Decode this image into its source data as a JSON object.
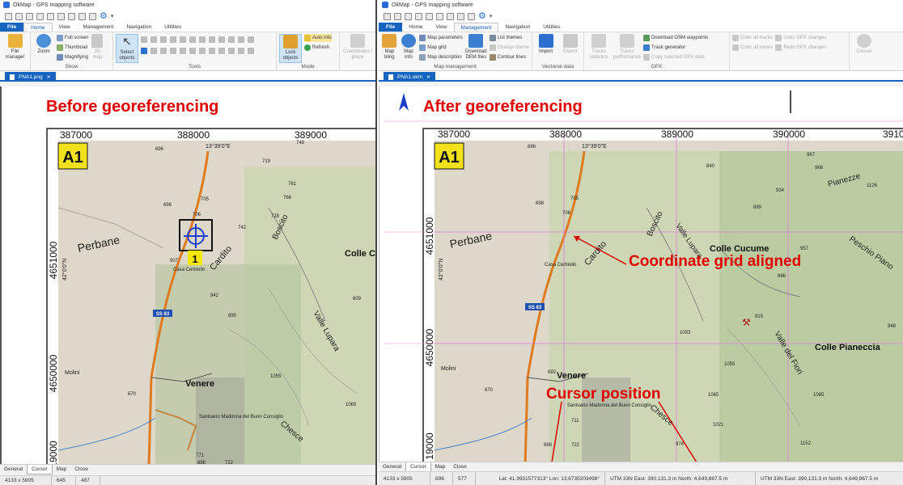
{
  "window": {
    "title": "OkMap - GPS mapping software"
  },
  "tabs": {
    "file": "File",
    "home": "Home",
    "view": "View",
    "management": "Management",
    "navigation": "Navigation",
    "utilities": "Utilities"
  },
  "left_ribbon": {
    "file_manager": "File manager",
    "zoom": "Zoom",
    "full_screen": "Full screen",
    "thumbnail": "Thumbnail",
    "magnifying": "Magnifying",
    "map_3d": "3D map",
    "show": "Show",
    "select_objects": "Select objects",
    "tools": "Tools",
    "lock_objects": "Lock objects",
    "auto_info": "Auto info",
    "refresh": "Refresh",
    "mode": "Mode",
    "coordinates_place": "Coordinates / place"
  },
  "right_ribbon": {
    "map_bling": "Map bling",
    "map_info": "Map info",
    "map_parameters": "Map parameters",
    "map_grid": "Map grid",
    "map_description": "Map description",
    "download_dem": "Download DEM files",
    "list_themes": "List themes",
    "change_theme": "Change theme",
    "contour_lines": "Contour lines",
    "map_management": "Map management",
    "import": "Import",
    "export": "Export",
    "vectorial_data": "Vectorial data",
    "tracks_statistics": "Tracks statistics",
    "tracks_performance": "Tracks performance",
    "download_osm": "Download OSM waypoints",
    "track_generator": "Track generator",
    "copy_gpx": "Copy selected GPX data",
    "gpx": "GPX",
    "color_all_tracks": "Color all tracks",
    "color_all_routes": "Color all routes",
    "undo_gpx": "Undo GPX changes",
    "redo_gpx": "Redo GPX changes",
    "convert": "Conver"
  },
  "left_doc": {
    "tab": "PNA1.png",
    "heading": "Before georeferencing"
  },
  "right_doc": {
    "tab": "PNA1.okm",
    "heading": "After georeferencing",
    "annotation_grid": "Coordinate grid aligned",
    "annotation_cursor": "Cursor position"
  },
  "map": {
    "sheet": "A1",
    "x_ticks_left": [
      "387000",
      "388000",
      "389000"
    ],
    "x_ticks_right": [
      "387000",
      "388000",
      "389000",
      "390000",
      "3910"
    ],
    "y_ticks": [
      "4651000",
      "4650000",
      "19000"
    ],
    "lon_label": "13°39'0\"E",
    "lat_label": "42°0'0\"N",
    "places": [
      "Perbane",
      "Cardito",
      "Boscito",
      "Valle Lupara",
      "Colle C",
      "Colle Cucume",
      "Pianezze",
      "Peschio Piano",
      "Colle Pianeccia",
      "Valle del Fiori",
      "Venere",
      "Molini",
      "Chesce",
      "Casa Cerbiollo",
      "Santuario Madonna del Buon Consiglio",
      "SS 83",
      "1"
    ],
    "elevations": [
      "696",
      "719",
      "748",
      "705",
      "706",
      "698",
      "708",
      "728",
      "742",
      "761",
      "766",
      "785",
      "805",
      "907",
      "842",
      "895",
      "840",
      "934",
      "899",
      "967",
      "966",
      "1126",
      "957",
      "886",
      "915",
      "948",
      "1033",
      "1055",
      "1065",
      "1021",
      "974",
      "1152",
      "670",
      "692",
      "711",
      "686",
      "722",
      "771",
      "609"
    ]
  },
  "bottom_tabs": [
    "General",
    "Cursor",
    "Map",
    "Close"
  ],
  "status_left": [
    "4133 x 5905",
    "645",
    "487"
  ],
  "status_right": [
    "4133 x 5905",
    "896",
    "577",
    "Lat: 41.9931577313°  Lon: 13.6735203498°",
    "UTM 33N  East: 390,131.3  m  North: 4,649,867.5  m",
    "UTM 33N  East: 390,131.3  m  North: 4,649,867.5  m"
  ]
}
